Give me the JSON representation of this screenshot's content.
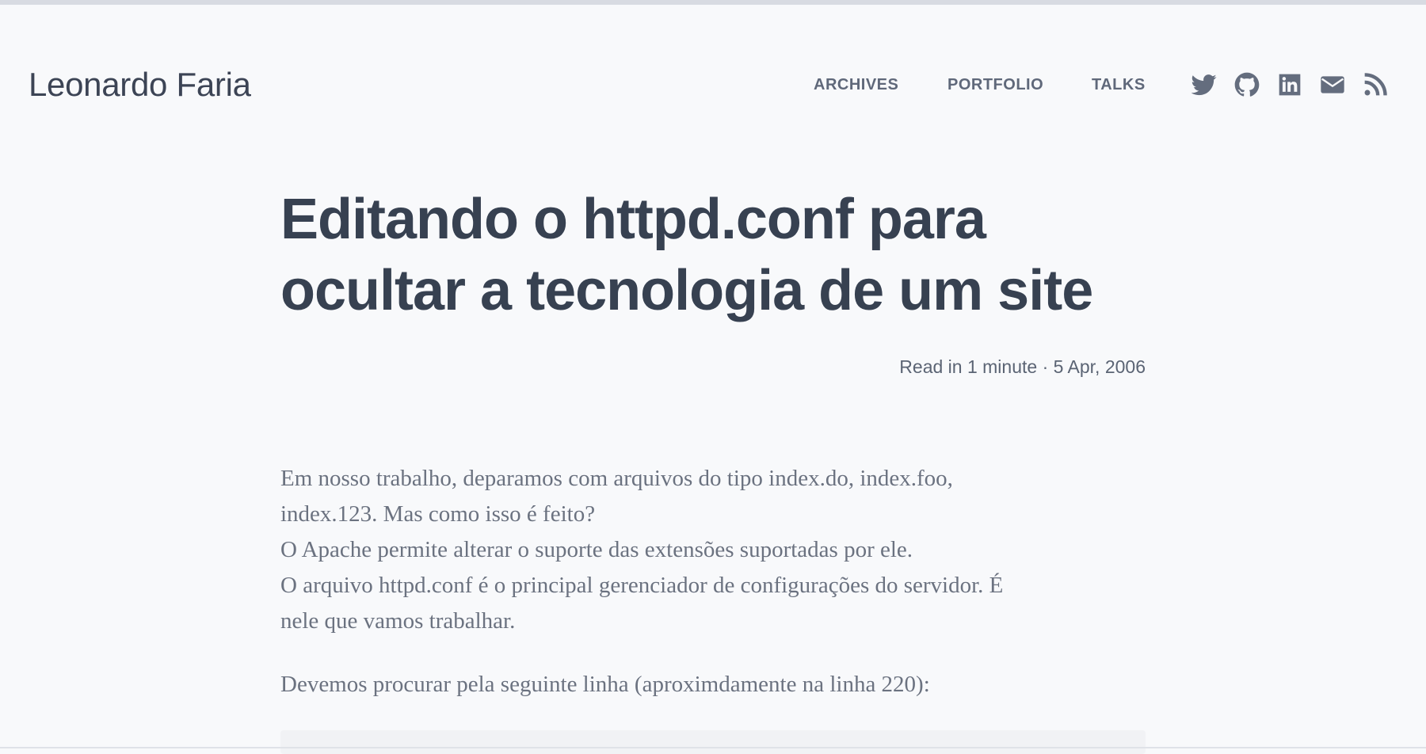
{
  "header": {
    "site_title": "Leonardo Faria",
    "nav": [
      {
        "label": "ARCHIVES"
      },
      {
        "label": "PORTFOLIO"
      },
      {
        "label": "TALKS"
      }
    ],
    "social_icons": [
      "twitter-icon",
      "github-icon",
      "linkedin-icon",
      "email-icon",
      "rss-icon"
    ]
  },
  "article": {
    "title": "Editando o httpd.conf para ocultar a tecnologia de um site",
    "meta": "Read in 1 minute · 5 Apr, 2006",
    "paragraph_1_lines": [
      "Em nosso trabalho, deparamos com arquivos do tipo index.do, index.foo,",
      "index.123. Mas como isso é feito?",
      "O Apache permite alterar o suporte das extensões suportadas por ele.",
      "O arquivo httpd.conf é o principal gerenciador de configurações do servidor. É",
      "nele que vamos trabalhar."
    ],
    "paragraph_2": "Devemos procurar pela seguinte linha (aproximdamente na linha 220):"
  },
  "colors": {
    "background": "#f8f9fb",
    "title": "#374151",
    "nav": "#5f687a",
    "icon": "#646d7e",
    "body_text": "#6b7280"
  }
}
